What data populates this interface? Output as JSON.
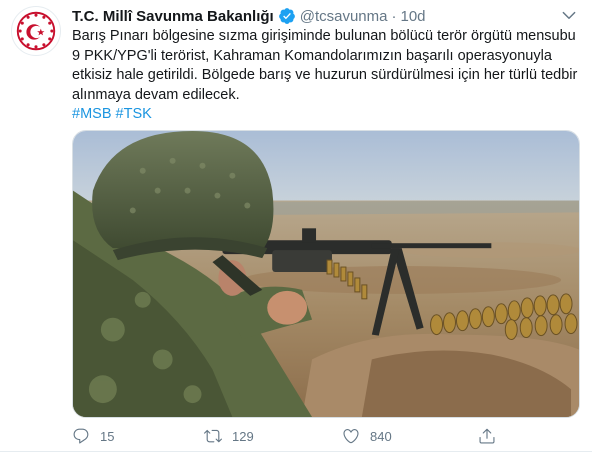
{
  "tweet": {
    "author_name": "T.C. Millî Savunma Bakanlığı",
    "handle": "@tcsavunma",
    "separator": "·",
    "time": "10d",
    "text": "Barış Pınarı bölgesine sızma girişiminde bulunan bölücü terör örgütü mensubu 9 PKK/YPG'li terörist, Kahraman Komandolarımızın başarılı operasyonuyla etkisiz hale getirildi. Bölgede barış ve huzurun sürdürülmesi için her türlü tedbir alınmaya devam edilecek.",
    "hashtags": [
      "#MSB",
      "#TSK"
    ],
    "media_icon": "photo-soldier-machine-gun",
    "counts": {
      "replies": "15",
      "retweets": "129",
      "likes": "840"
    }
  },
  "icons": {
    "verified": "verified-badge-icon",
    "caret": "chevron-down-icon",
    "reply": "reply-icon",
    "retweet": "retweet-icon",
    "like": "heart-icon",
    "share": "share-icon"
  },
  "colors": {
    "link": "#1b95e0",
    "muted": "#657786",
    "verified": "#1da1f2",
    "logo_red": "#c8102e"
  }
}
